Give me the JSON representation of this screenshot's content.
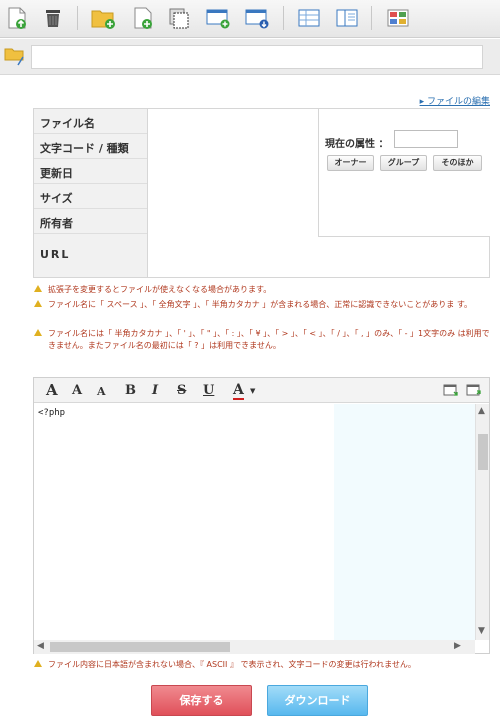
{
  "toolbar": {
    "buttons": [
      {
        "name": "upload-file-icon"
      },
      {
        "name": "trash-icon"
      },
      {
        "name": "new-folder-icon"
      },
      {
        "name": "new-file-icon"
      },
      {
        "name": "copy-icon"
      },
      {
        "name": "new-window-icon"
      },
      {
        "name": "window-download-icon"
      },
      {
        "name": "list-view-icon"
      },
      {
        "name": "detail-view-icon"
      },
      {
        "name": "thumbnail-view-icon"
      }
    ]
  },
  "path": {
    "value": ""
  },
  "help_link": "ファイルの編集",
  "info": {
    "labels": {
      "filename": "ファイル名",
      "charcode": "文字コード / 種類",
      "updated": "更新日",
      "size": "サイズ",
      "owner": "所有者",
      "url": "URL"
    }
  },
  "attributes": {
    "label": "現在の属性 ：",
    "value": "",
    "owner_btn": "オーナー",
    "group_btn": "グループ",
    "other_btn": "そのほか"
  },
  "warnings": [
    "拡張子を変更するとファイルが使えなくなる場合があります。",
    "ファイル名に「 スペース 」、「 全角文字 」、「 半角カタカナ 」が含まれる場合、正常に認識できないことがありま す。",
    "ファイル名には「 半角カタカナ 」、「 ' 」、「 \" 」、「 : 」、「 ¥ 」、「 > 」、「 < 」、「 / 」、「 , 」のみ、「 - 」1文字のみ は利用できません。またファイル名の最初には「 ? 」は利用できません。"
  ],
  "editor": {
    "format": {
      "big_a": "A",
      "mid_a": "A",
      "small_a": "A",
      "bold": "B",
      "italic": "I",
      "strike": "S",
      "underline": "U",
      "color": "A"
    },
    "content": "<?php"
  },
  "bottom_warning": "ファイル内容に日本語が含まれない場合、『 ASCII 』 で表示され、文字コードの変更は行われません。",
  "actions": {
    "save": "保存する",
    "download": "ダウンロード"
  },
  "colors": {
    "save": "#e0505a",
    "download": "#58b8ee",
    "warning_text": "#b0381e",
    "link": "#2a6fb0"
  }
}
